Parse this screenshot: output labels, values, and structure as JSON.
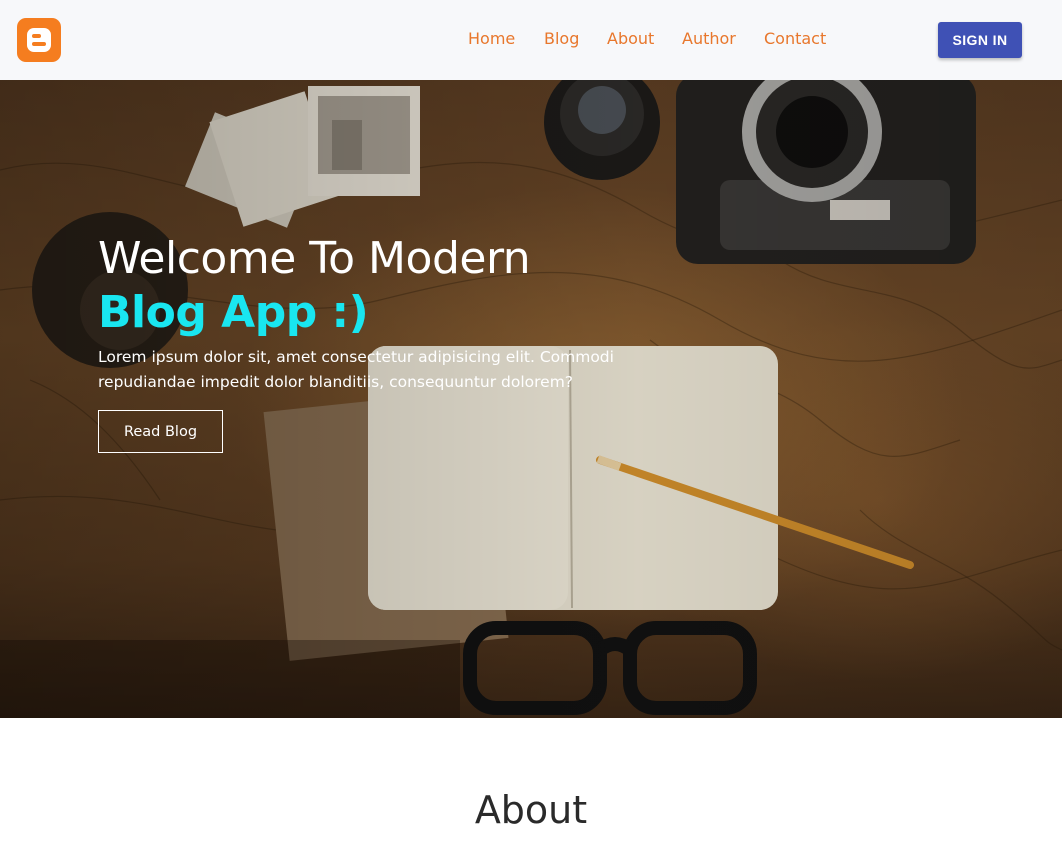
{
  "navbar": {
    "logo_icon": "blogger-logo-icon",
    "brand_color": "#f57d1f",
    "links": [
      {
        "label": "Home"
      },
      {
        "label": "Blog"
      },
      {
        "label": "About"
      },
      {
        "label": "Author"
      },
      {
        "label": "Contact"
      }
    ],
    "link_color": "#e8772c",
    "signin_label": "SIGN IN",
    "signin_color": "#3f51b5"
  },
  "hero": {
    "title_line1": "Welcome To Modern",
    "title_line2": "Blog App :)",
    "accent_color": "#19e6f0",
    "text": "Lorem ipsum dolor sit, amet consectetur adipisicing elit. Commodi repudiandae impedit dolor blanditiis, consequuntur dolorem?",
    "button_label": "Read Blog"
  },
  "about": {
    "title": "About"
  }
}
